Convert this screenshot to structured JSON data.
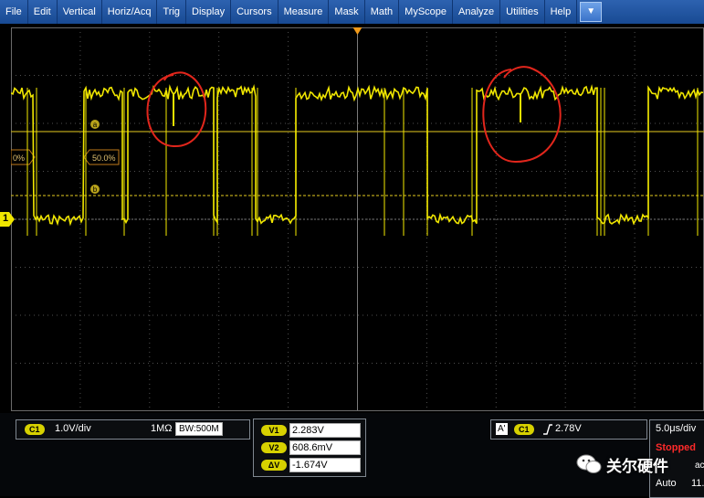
{
  "menu": [
    "File",
    "Edit",
    "Vertical",
    "Horiz/Acq",
    "Trig",
    "Display",
    "Cursors",
    "Measure",
    "Mask",
    "Math",
    "MyScope",
    "Analyze",
    "Utilities",
    "Help"
  ],
  "menu_dropdown_icon": "chevron-down-icon",
  "cursors": {
    "a_label": "a",
    "b_label": "b",
    "left_pct_label": "0%",
    "pct_label": "50.0%"
  },
  "channel_marker": "1",
  "channel": {
    "chip": "C1",
    "scale": "1.0V/div",
    "impedance": "1MΩ",
    "bandwidth": "BW:500M"
  },
  "measurements": [
    {
      "label": "V1",
      "value": "2.283V"
    },
    {
      "label": "V2",
      "value": "608.6mV"
    },
    {
      "label": "ΔV",
      "value": "-1.674V"
    }
  ],
  "trigger": {
    "a_label": "A'",
    "chip": "C1",
    "slope_icon": "rising-edge-icon",
    "level": "2.78V"
  },
  "timebase": {
    "scale": "5.0μs/div",
    "status": "Stopped",
    "acq": "acqs",
    "mode": "Auto",
    "extra": "11."
  },
  "watermark": "关尔硬件",
  "colors": {
    "trace": "#f0e600",
    "menubar": "#1f55a3",
    "stopped": "#ff2a2a",
    "annotation": "#e1261c"
  }
}
